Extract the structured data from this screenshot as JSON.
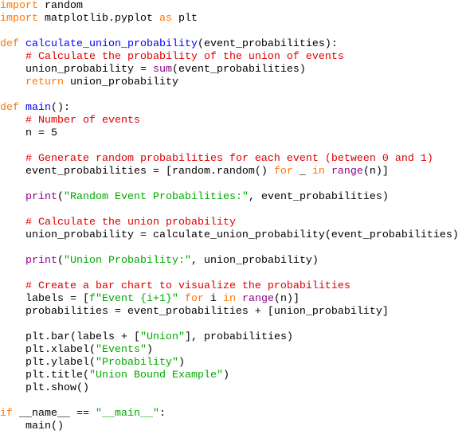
{
  "editor": {
    "language": "python",
    "colors": {
      "keyword": "#FF7700",
      "function_name": "#0000FF",
      "comment": "#DD0000",
      "string": "#00AA00",
      "builtin": "#900090",
      "text": "#000000"
    },
    "lines": [
      [
        {
          "t": "kw",
          "v": "import"
        },
        {
          "t": "tx",
          "v": " random"
        }
      ],
      [
        {
          "t": "kw",
          "v": "import"
        },
        {
          "t": "tx",
          "v": " matplotlib.pyplot "
        },
        {
          "t": "kw",
          "v": "as"
        },
        {
          "t": "tx",
          "v": " plt"
        }
      ],
      [],
      [
        {
          "t": "kw",
          "v": "def"
        },
        {
          "t": "tx",
          "v": " "
        },
        {
          "t": "fn",
          "v": "calculate_union_probability"
        },
        {
          "t": "tx",
          "v": "(event_probabilities):"
        }
      ],
      [
        {
          "t": "tx",
          "v": "    "
        },
        {
          "t": "cm",
          "v": "# Calculate the probability of the union of events"
        }
      ],
      [
        {
          "t": "tx",
          "v": "    union_probability = "
        },
        {
          "t": "bi",
          "v": "sum"
        },
        {
          "t": "tx",
          "v": "(event_probabilities)"
        }
      ],
      [
        {
          "t": "tx",
          "v": "    "
        },
        {
          "t": "kw",
          "v": "return"
        },
        {
          "t": "tx",
          "v": " union_probability"
        }
      ],
      [],
      [
        {
          "t": "kw",
          "v": "def"
        },
        {
          "t": "tx",
          "v": " "
        },
        {
          "t": "fn",
          "v": "main"
        },
        {
          "t": "tx",
          "v": "():"
        }
      ],
      [
        {
          "t": "tx",
          "v": "    "
        },
        {
          "t": "cm",
          "v": "# Number of events"
        }
      ],
      [
        {
          "t": "tx",
          "v": "    n = 5"
        }
      ],
      [],
      [
        {
          "t": "tx",
          "v": "    "
        },
        {
          "t": "cm",
          "v": "# Generate random probabilities for each event (between 0 and 1)"
        }
      ],
      [
        {
          "t": "tx",
          "v": "    event_probabilities = [random.random() "
        },
        {
          "t": "kw",
          "v": "for"
        },
        {
          "t": "tx",
          "v": " _ "
        },
        {
          "t": "kw",
          "v": "in"
        },
        {
          "t": "tx",
          "v": " "
        },
        {
          "t": "bi",
          "v": "range"
        },
        {
          "t": "tx",
          "v": "(n)]"
        }
      ],
      [],
      [
        {
          "t": "tx",
          "v": "    "
        },
        {
          "t": "bi",
          "v": "print"
        },
        {
          "t": "tx",
          "v": "("
        },
        {
          "t": "st",
          "v": "\"Random Event Probabilities:\""
        },
        {
          "t": "tx",
          "v": ", event_probabilities)"
        }
      ],
      [],
      [
        {
          "t": "tx",
          "v": "    "
        },
        {
          "t": "cm",
          "v": "# Calculate the union probability"
        }
      ],
      [
        {
          "t": "tx",
          "v": "    union_probability = calculate_union_probability(event_probabilities)"
        }
      ],
      [],
      [
        {
          "t": "tx",
          "v": "    "
        },
        {
          "t": "bi",
          "v": "print"
        },
        {
          "t": "tx",
          "v": "("
        },
        {
          "t": "st",
          "v": "\"Union Probability:\""
        },
        {
          "t": "tx",
          "v": ", union_probability)"
        }
      ],
      [],
      [
        {
          "t": "tx",
          "v": "    "
        },
        {
          "t": "cm",
          "v": "# Create a bar chart to visualize the probabilities"
        }
      ],
      [
        {
          "t": "tx",
          "v": "    labels = ["
        },
        {
          "t": "st",
          "v": "f\"Event {i+1}\""
        },
        {
          "t": "tx",
          "v": " "
        },
        {
          "t": "kw",
          "v": "for"
        },
        {
          "t": "tx",
          "v": " i "
        },
        {
          "t": "kw",
          "v": "in"
        },
        {
          "t": "tx",
          "v": " "
        },
        {
          "t": "bi",
          "v": "range"
        },
        {
          "t": "tx",
          "v": "(n)]"
        }
      ],
      [
        {
          "t": "tx",
          "v": "    probabilities = event_probabilities + [union_probability]"
        }
      ],
      [],
      [
        {
          "t": "tx",
          "v": "    plt.bar(labels + ["
        },
        {
          "t": "st",
          "v": "\"Union\""
        },
        {
          "t": "tx",
          "v": "], probabilities)"
        }
      ],
      [
        {
          "t": "tx",
          "v": "    plt.xlabel("
        },
        {
          "t": "st",
          "v": "\"Events\""
        },
        {
          "t": "tx",
          "v": ")"
        }
      ],
      [
        {
          "t": "tx",
          "v": "    plt.ylabel("
        },
        {
          "t": "st",
          "v": "\"Probability\""
        },
        {
          "t": "tx",
          "v": ")"
        }
      ],
      [
        {
          "t": "tx",
          "v": "    plt.title("
        },
        {
          "t": "st",
          "v": "\"Union Bound Example\""
        },
        {
          "t": "tx",
          "v": ")"
        }
      ],
      [
        {
          "t": "tx",
          "v": "    plt.show()"
        }
      ],
      [],
      [
        {
          "t": "kw",
          "v": "if"
        },
        {
          "t": "tx",
          "v": " __name__ == "
        },
        {
          "t": "st",
          "v": "\"__main__\""
        },
        {
          "t": "tx",
          "v": ":"
        }
      ],
      [
        {
          "t": "tx",
          "v": "    main()"
        }
      ]
    ]
  }
}
